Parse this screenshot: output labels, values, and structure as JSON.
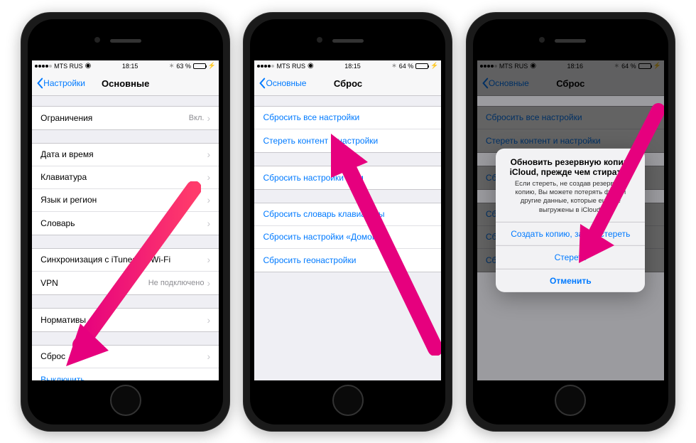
{
  "phone1": {
    "status": {
      "carrier": "MTS RUS",
      "time": "18:15",
      "battery": "63 %"
    },
    "nav": {
      "back": "Настройки",
      "title": "Основные"
    },
    "rows": {
      "restrictions": "Ограничения",
      "restrictions_val": "Вкл.",
      "datetime": "Дата и время",
      "keyboard": "Клавиатура",
      "lang": "Язык и регион",
      "dict": "Словарь",
      "itunes": "Синхронизация с iTunes по Wi-Fi",
      "vpn": "VPN",
      "vpn_val": "Не подключено",
      "norms": "Нормативы",
      "reset": "Сброс",
      "shutdown": "Выключить"
    }
  },
  "phone2": {
    "status": {
      "carrier": "MTS RUS",
      "time": "18:15",
      "battery": "64 %"
    },
    "nav": {
      "back": "Основные",
      "title": "Сброс"
    },
    "rows": {
      "reset_all": "Сбросить все настройки",
      "erase_all": "Стереть контент и настройки",
      "reset_net": "Сбросить настройки сети",
      "reset_kb": "Сбросить словарь клавиатуры",
      "reset_home": "Сбросить настройки «Домой»",
      "reset_geo": "Сбросить геонастройки"
    }
  },
  "phone3": {
    "status": {
      "carrier": "MTS RUS",
      "time": "18:16",
      "battery": "64 %"
    },
    "nav": {
      "back": "Основные",
      "title": "Сброс"
    },
    "rows": {
      "reset_all": "Сбросить все настройки",
      "erase_all": "Стереть контент и настройки",
      "reset_net": "Сбросить настройки сети",
      "reset_kb": "Сбросить словарь клавиатуры",
      "reset_home": "Сбросить настройки «Домой»",
      "reset_geo": "Сбросить геонастройки"
    },
    "alert": {
      "title": "Обновить резервную копию iCloud, прежде чем стирать?",
      "msg": "Если стереть, не создав резервную копию, Вы можете потерять фото и другие данные, которые еще не выгружены в iCloud.",
      "btn1": "Создать копию, затем стереть",
      "btn2": "Стереть",
      "btn3": "Отменить"
    }
  }
}
